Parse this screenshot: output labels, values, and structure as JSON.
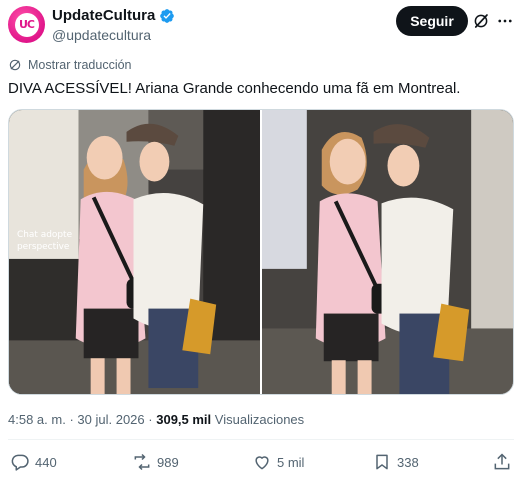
{
  "author": {
    "display_name": "UpdateCultura",
    "handle": "@updatecultura",
    "avatar_text": "UC",
    "verified": true
  },
  "header": {
    "follow_label": "Seguir"
  },
  "translate": {
    "label": "Mostrar traducción"
  },
  "post": {
    "text": "DIVA ACESSÍVEL! Ariana Grande conhecendo uma fã em Montreal."
  },
  "meta": {
    "time": "4:58 a. m.",
    "separator": "·",
    "date": "30 jul. 2026",
    "views_count": "309,5 mil",
    "views_label": "Visualizaciones"
  },
  "actions": {
    "replies": "440",
    "reposts": "989",
    "likes": "5 mil",
    "bookmarks": "338"
  },
  "photo_overlay": {
    "left_sign": "Chat adopte perspective"
  },
  "colors": {
    "brand_pink": "#e0168a",
    "verified_blue": "#1d9bf0",
    "text_primary": "#0f1419",
    "text_secondary": "#536471"
  },
  "icons": [
    "verified-badge-icon",
    "grok-icon",
    "more-icon",
    "translate-icon",
    "reply-icon",
    "repost-icon",
    "like-icon",
    "bookmark-icon",
    "share-icon"
  ]
}
